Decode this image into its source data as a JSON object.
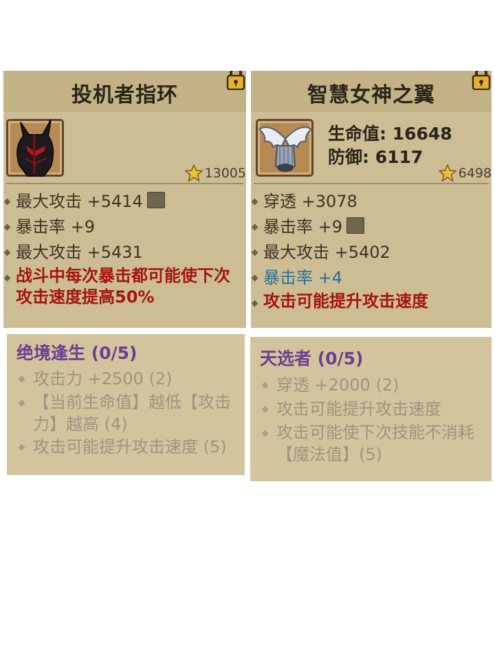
{
  "left_card": {
    "title": "投机者指环",
    "item_icon": "dark-horned-helmet-icon",
    "score": "13005",
    "stats": [
      {
        "text": "最大攻击 +5414",
        "forge": true
      },
      {
        "text": "暴击率 +9"
      },
      {
        "text": "最大攻击 +5431"
      }
    ],
    "special": "战斗中每次暴击都可能使下次攻击速度提高50%"
  },
  "right_card": {
    "title": "智慧女神之翼",
    "item_icon": "white-wings-icon",
    "hp": "生命值: 16648",
    "defense": "防御: 6117",
    "score": "6498",
    "stats": [
      {
        "text": "穿透 +3078"
      },
      {
        "text": "暴击率 +9",
        "forge": true
      },
      {
        "text": "最大攻击 +5402"
      },
      {
        "text": "暴击率 +4",
        "color": "#2d6f91"
      }
    ],
    "special": "攻击可能提升攻击速度"
  },
  "left_set": {
    "title": "绝境逢生 (0/5)",
    "lines": [
      "攻击力 +2500 (2)",
      "【当前生命值】越低【攻击力】越高 (4)",
      "攻击可能提升攻击速度 (5)"
    ]
  },
  "right_set": {
    "title": "天选者 (0/5)",
    "lines": [
      "穿透 +2000 (2)",
      "攻击可能提升攻击速度",
      "攻击可能使下次技能不消耗【魔法值】(5)"
    ]
  },
  "colors": {
    "panel": "#cdbd95",
    "set_title": "#6b3f8f",
    "special_red": "#a5140e",
    "blue_stat": "#2d6f91"
  }
}
